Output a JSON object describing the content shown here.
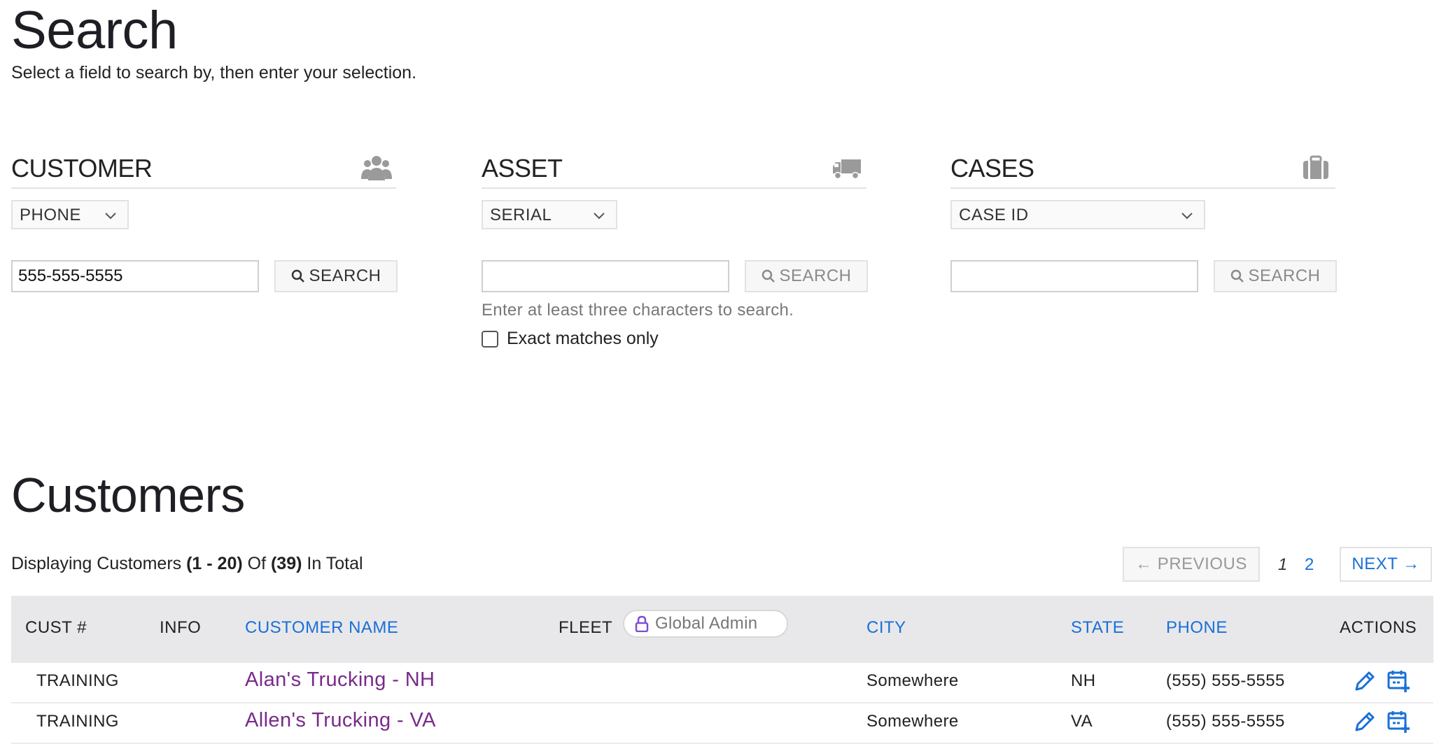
{
  "search": {
    "title": "Search",
    "subtitle": "Select a field to search by, then enter your selection."
  },
  "panels": [
    {
      "name": "CUSTOMER",
      "icon": "users-icon",
      "select": "PHONE",
      "input_value": "555-555-5555",
      "button": "SEARCH"
    },
    {
      "name": "ASSET",
      "icon": "truck-icon",
      "select": "SERIAL",
      "input_value": "",
      "button": "SEARCH",
      "hint": "Enter at least three characters to search.",
      "checkbox_label": "Exact matches only"
    },
    {
      "name": "CASES",
      "icon": "briefcase-icon",
      "select": "CASE ID",
      "input_value": "",
      "button": "SEARCH"
    }
  ],
  "customers": {
    "title": "Customers",
    "display_prefix": "Displaying Customers ",
    "display_range": "(1 - 20)",
    "display_mid": " Of ",
    "display_total": "(39)",
    "display_suffix": " In Total",
    "pagination": {
      "previous": "← PREVIOUS",
      "pages": [
        "1",
        "2"
      ],
      "current": "1",
      "next": "NEXT →"
    },
    "columns": {
      "cust": "CUST #",
      "info": "INFO",
      "name": "CUSTOMER NAME",
      "fleet": "FLEET",
      "fleet_badge": "Global Admin",
      "city": "CITY",
      "state": "STATE",
      "phone": "PHONE",
      "actions": "ACTIONS"
    },
    "rows": [
      {
        "cust": "TRAINING",
        "name": "Alan's Trucking - NH",
        "city": "Somewhere",
        "state": "NH",
        "phone": "(555) 555-5555"
      },
      {
        "cust": "TRAINING",
        "name": "Allen's Trucking - VA",
        "city": "Somewhere",
        "state": "VA",
        "phone": "(555) 555-5555"
      }
    ]
  },
  "colors": {
    "link": "#1a6fd8",
    "customer_name": "#7a2a8a",
    "lock": "#7b4fd6",
    "header_bg": "#e8e8ea"
  }
}
